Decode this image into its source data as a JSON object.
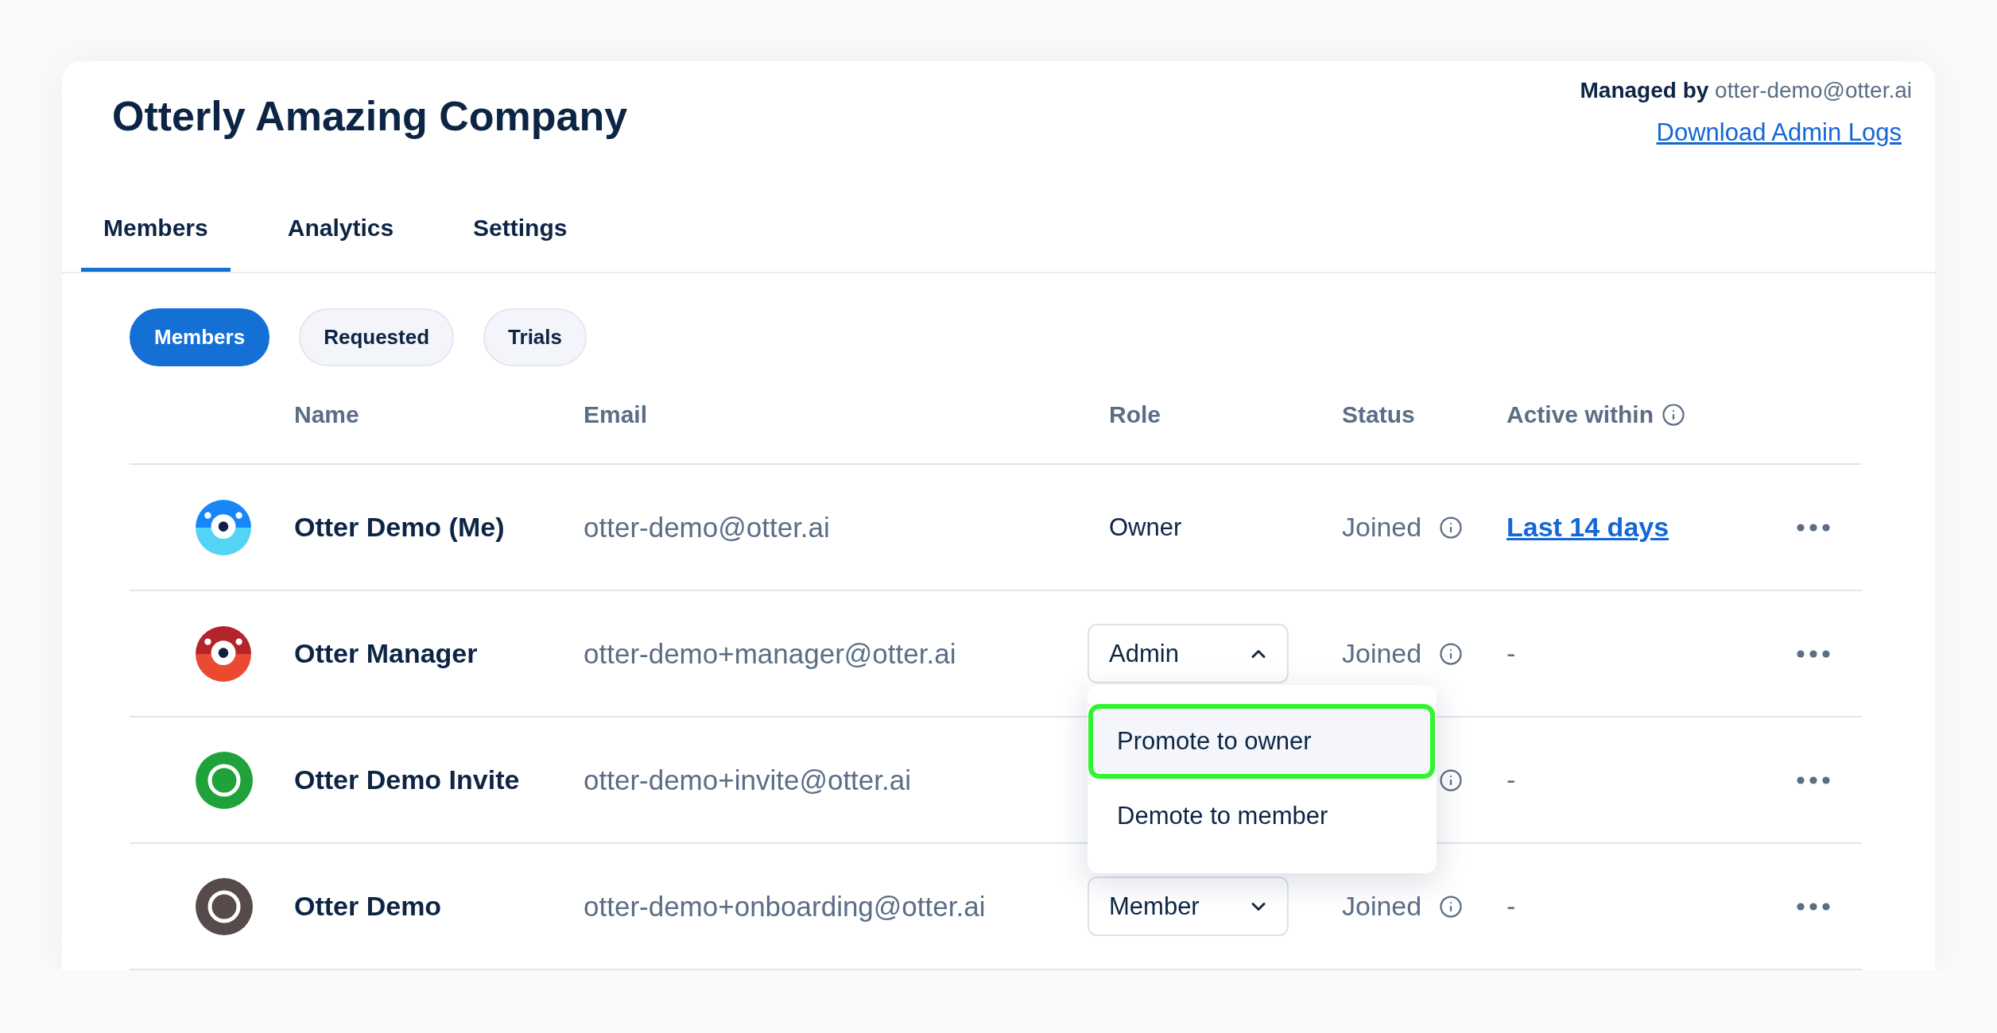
{
  "header": {
    "title": "Otterly Amazing Company",
    "managed_by": "**Managed by** otter-demo@otter.ai",
    "download_link": "Download Admin Logs"
  },
  "tabs": [
    {
      "label": "Members",
      "selected": true
    },
    {
      "label": "Analytics",
      "selected": false
    },
    {
      "label": "Settings",
      "selected": false
    }
  ],
  "filters": [
    {
      "label": "Members",
      "selected": true
    },
    {
      "label": "Requested",
      "selected": false
    },
    {
      "label": "Trials",
      "selected": false
    }
  ],
  "table": {
    "columns": [
      {
        "label": "Name",
        "info": false
      },
      {
        "label": "Email",
        "info": false
      },
      {
        "label": "Role",
        "info": false
      },
      {
        "label": "Status",
        "info": false
      },
      {
        "label": "Active within",
        "info": true
      }
    ],
    "rows": [
      {
        "avatar": {
          "kind": "otter",
          "halves": [
            {
              "color": "#1787f8"
            },
            {
              "color": "#54d4f4"
            }
          ]
        },
        "name": "Otter Demo (Me)",
        "email": "otter-demo@otter.ai",
        "role": {
          "kind": "text",
          "label": "Owner"
        },
        "status": {
          "label": "Joined",
          "info": true
        },
        "active": {
          "kind": "link",
          "label": "Last 14 days"
        }
      },
      {
        "avatar": {
          "kind": "otter",
          "halves": [
            {
              "color": "#b3242b"
            },
            {
              "color": "#ea4a30"
            }
          ]
        },
        "name": "Otter Manager",
        "email": "otter-demo+manager@otter.ai",
        "role": {
          "kind": "dropdown",
          "label": "Admin",
          "expanded": true,
          "menu": [
            {
              "label": "Promote to owner",
              "selected": true
            },
            {
              "label": "Demote to member",
              "selected": false
            }
          ]
        },
        "status": {
          "label": "Joined",
          "info": true
        },
        "active": {
          "kind": "text",
          "label": "-"
        }
      },
      {
        "avatar": {
          "kind": "ring",
          "color": "#1fa23a"
        },
        "name": "Otter Demo Invite",
        "email": "otter-demo+invite@otter.ai",
        "status": {
          "info": true
        },
        "active": {
          "kind": "text",
          "label": "-"
        }
      },
      {
        "avatar": {
          "kind": "ring",
          "color": "#564a4a"
        },
        "name": "Otter Demo",
        "email": "otter-demo+onboarding@otter.ai",
        "role": {
          "kind": "dropdown",
          "label": "Member",
          "expanded": false
        },
        "status": {
          "label": "Joined",
          "info": true
        },
        "active": {
          "kind": "text",
          "label": "-"
        }
      }
    ]
  }
}
